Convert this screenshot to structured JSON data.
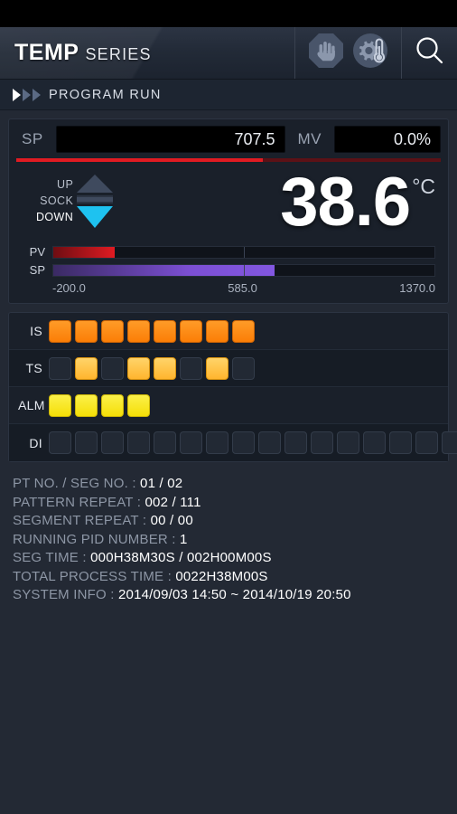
{
  "header": {
    "brand_main": "TEMP",
    "brand_sub": "SERIES",
    "icons": [
      {
        "name": "manual-stop-icon",
        "label": "MANUAL"
      },
      {
        "name": "autotune-icon",
        "label": "AUTO TUNE"
      },
      {
        "name": "search-icon",
        "label": "SEARCH"
      }
    ]
  },
  "run_strip": {
    "label": "PROGRAM RUN"
  },
  "control": {
    "sp_label": "SP",
    "sp_value": "707.5",
    "mv_label": "MV",
    "mv_value": "0.0%",
    "progress_percent": 58
  },
  "process": {
    "pv_value": "38.6",
    "pv_unit": "°C",
    "ramp": {
      "up_label": "UP",
      "soak_label": "SOCK",
      "down_label": "DOWN",
      "active": "DOWN"
    },
    "meters": [
      {
        "name": "PV",
        "fill_percent": 16,
        "color": "#e01b22"
      },
      {
        "name": "SP",
        "fill_percent": 58,
        "color": "#7c4fd4"
      }
    ],
    "scale": {
      "min": "-200.0",
      "mid": "585.0",
      "max": "1370.0"
    }
  },
  "indicators": [
    {
      "name": "IS",
      "count": 8,
      "states": [
        1,
        1,
        1,
        1,
        1,
        1,
        1,
        1
      ],
      "style": "is"
    },
    {
      "name": "TS",
      "count": 8,
      "states": [
        0,
        1,
        0,
        1,
        1,
        0,
        1,
        0
      ],
      "style": "ts"
    },
    {
      "name": "ALM",
      "count": 4,
      "states": [
        1,
        1,
        1,
        1
      ],
      "style": "alm"
    },
    {
      "name": "DI",
      "count": 16,
      "states": [
        0,
        0,
        0,
        0,
        0,
        0,
        0,
        0,
        0,
        0,
        0,
        0,
        0,
        0,
        0,
        0
      ],
      "style": "di"
    }
  ],
  "info": [
    {
      "key": "PT NO. / SEG NO. :",
      "value": "01 / 02"
    },
    {
      "key": "PATTERN REPEAT :",
      "value": "002 / 111"
    },
    {
      "key": "SEGMENT REPEAT :",
      "value": "00 / 00"
    },
    {
      "key": "RUNNING PID NUMBER :",
      "value": "1"
    },
    {
      "key": "SEG TIME :",
      "value": "000H38M30S / 002H00M00S"
    },
    {
      "key": "TOTAL PROCESS TIME :",
      "value": "0022H38M00S"
    },
    {
      "key": "SYSTEM INFO :",
      "value": "2014/09/03 14:50 ~ 2014/10/19 20:50"
    }
  ],
  "colors": {
    "page_bg": "#232934",
    "panel_bg": "#1a202a",
    "accent_red": "#e01b22",
    "accent_purple": "#7c4fd4",
    "accent_cyan": "#1ec2f0",
    "is_on": "#fb7e06",
    "ts_on": "#ffb52e",
    "alm_on": "#f5df07"
  }
}
